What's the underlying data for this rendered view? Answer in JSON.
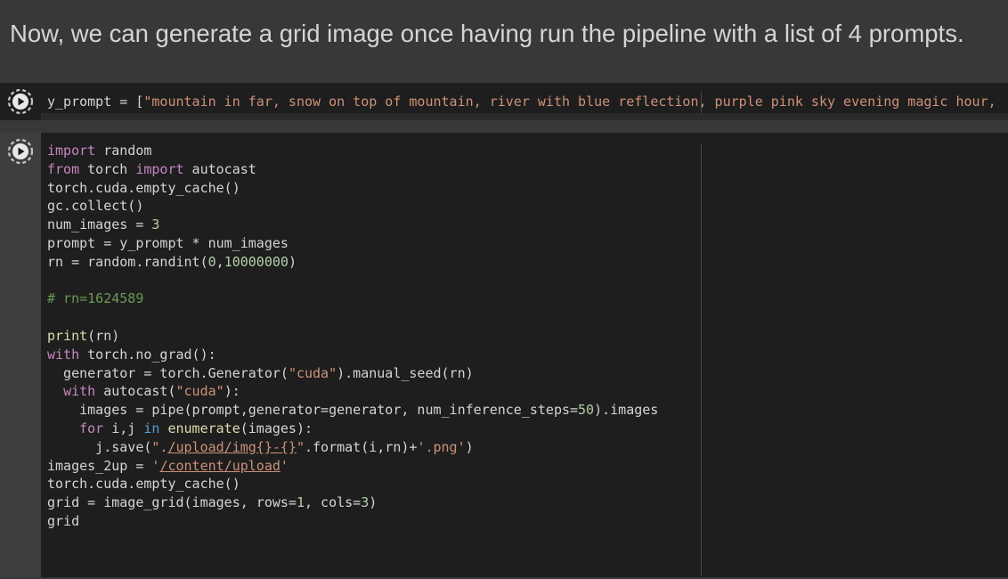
{
  "markdown": {
    "text": "Now, we can generate a grid image once having run the pipeline with a list of 4 prompts."
  },
  "cell1": {
    "code_line": "y_prompt = [\"mountain in far, snow on top of mountain, river with blue reflection, purple pink sky evening magic hour,"
  },
  "cell2": {
    "lines": [
      "import random",
      "from torch import autocast",
      "torch.cuda.empty_cache()",
      "gc.collect()",
      "num_images = 3",
      "prompt = y_prompt * num_images",
      "rn = random.randint(0,10000000)",
      "",
      "# rn=1624589",
      "",
      "print(rn)",
      "with torch.no_grad():",
      "  generator = torch.Generator(\"cuda\").manual_seed(rn)",
      "  with autocast(\"cuda\"):",
      "    images = pipe(prompt,generator=generator, num_inference_steps=50).images",
      "    for i,j in enumerate(images):",
      "      j.save(\"./upload/img{}-{}\".format(i,rn)+'.png')",
      "images_2up = '/content/upload'",
      "torch.cuda.empty_cache()",
      "grid = image_grid(images, rows=1, cols=3)",
      "grid"
    ]
  },
  "icons": {
    "run": "run-cell-icon"
  },
  "colors": {
    "editor_bg": "#1e1e1e",
    "page_bg": "#383838",
    "keyword": "#c586c0",
    "string": "#ce9178",
    "number": "#b5cea8",
    "comment": "#6a9955",
    "function": "#dcdcaa"
  }
}
